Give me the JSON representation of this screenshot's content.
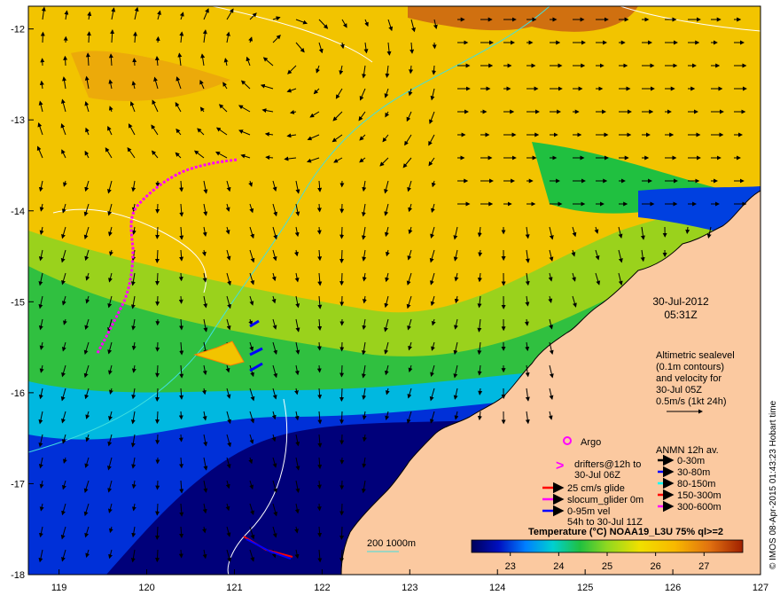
{
  "map": {
    "lon_ticks": [
      "119",
      "120",
      "121",
      "122",
      "123",
      "124",
      "125",
      "126",
      "127"
    ],
    "lat_ticks": [
      "-12",
      "-13",
      "-14",
      "-15",
      "-16",
      "-17",
      "-18"
    ],
    "lon_range": [
      118.65,
      127.0
    ],
    "lat_range": [
      -11.75,
      -18.0
    ]
  },
  "info": {
    "date": "30-Jul-2012",
    "time": "05:31Z",
    "altimetry_lines": [
      "Altimetric sealevel",
      "(0.1m contours)",
      "and velocity for",
      "30-Jul 05Z",
      "0.5m/s (1kt 24h)"
    ],
    "credit": "© IMOS 08-Apr-2015 01:43:23 Hobart time"
  },
  "legend": {
    "argo": "Argo",
    "drifters_lines": [
      "drifters@12h to",
      "30-Jul 06Z"
    ],
    "glide": "25 cm/s glide",
    "slocum": "slocum_glider 0m",
    "vel_lines": [
      "0-95m vel",
      "54h to 30-Jul 11Z"
    ],
    "anmn_title": "ANMN 12h av.",
    "anmn_items": [
      {
        "label": "0-30m",
        "color": "#000000"
      },
      {
        "label": "30-80m",
        "color": "#0000ff"
      },
      {
        "label": "80-150m",
        "color": "#00ffff"
      },
      {
        "label": "150-300m",
        "color": "#ff0000"
      },
      {
        "label": "300-600m",
        "color": "#ff00ff"
      }
    ],
    "isobaths": "200  1000m"
  },
  "colorbar": {
    "title": "Temperature (°C) NOAA19_L3U 75% ql>=2",
    "ticks": [
      "23",
      "24",
      "25",
      "26",
      "27"
    ],
    "colors": [
      "#00005a",
      "#0000a8",
      "#0040ff",
      "#00a0ff",
      "#00d8c0",
      "#20c040",
      "#80d020",
      "#d8e000",
      "#f8c800",
      "#f09020",
      "#c05000",
      "#a02000"
    ]
  },
  "colors": {
    "land": "#fbc9a0",
    "isobath_200": "#40e0e0",
    "isobath_1000": "#ffffff",
    "drifter": "#ff00ff",
    "glider": "#ff0000",
    "velocity": "#0000ff"
  }
}
